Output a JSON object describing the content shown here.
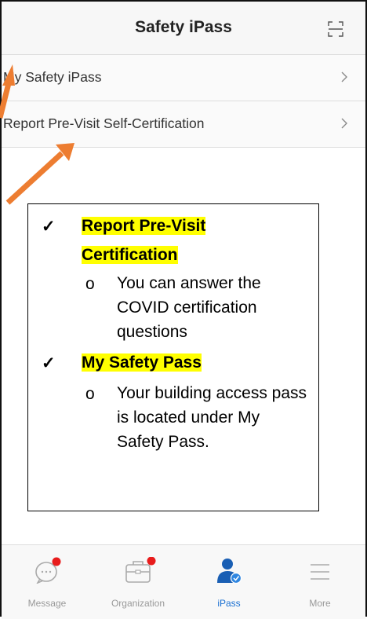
{
  "header": {
    "title": "Safety iPass",
    "scan_icon": "scan-icon"
  },
  "menu": {
    "items": [
      {
        "label": "My Safety iPass",
        "chevron": ">"
      },
      {
        "label": "Report Pre-Visit Self-Certification",
        "chevron": ">"
      }
    ]
  },
  "callout": {
    "items": [
      {
        "check": "✓",
        "title_line1": "Report Pre-Visit",
        "title_line2": "Certification",
        "bullet": "o",
        "sub": "You can answer the COVID certification questions"
      },
      {
        "check": "✓",
        "title_line1": "My Safety Pass",
        "bullet": "o",
        "sub": "Your building access pass is located under My Safety Pass."
      }
    ]
  },
  "tabbar": {
    "tabs": [
      {
        "label": "Message",
        "icon": "message-icon",
        "badge": true,
        "active": false
      },
      {
        "label": "Organization",
        "icon": "briefcase-icon",
        "badge": true,
        "active": false
      },
      {
        "label": "iPass",
        "icon": "user-check-icon",
        "badge": false,
        "active": true
      },
      {
        "label": "More",
        "icon": "menu-icon",
        "badge": false,
        "active": false
      }
    ]
  },
  "colors": {
    "accent": "#1a6fd1",
    "badge": "#e81c1c",
    "highlight": "#ffff00",
    "arrow": "#ed7d31"
  }
}
